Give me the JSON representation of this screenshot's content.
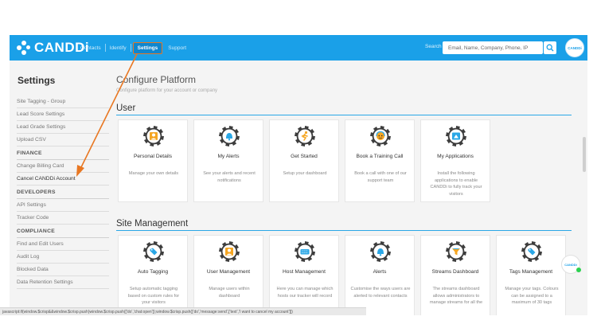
{
  "nav": {
    "brand": "CANDDi",
    "links": [
      "Contacts",
      "Identify",
      "Settings",
      "Support"
    ],
    "search_label": "Search",
    "search_placeholder": "Email, Name, Company, Phone, IP",
    "avatar_text": "CANDDi"
  },
  "sidebar": {
    "title": "Settings",
    "items": [
      {
        "label": "Site Tagging - Group",
        "type": "item"
      },
      {
        "label": "Lead Score Settings",
        "type": "item"
      },
      {
        "label": "Lead Grade Settings",
        "type": "item"
      },
      {
        "label": "Upload CSV",
        "type": "item"
      },
      {
        "label": "FINANCE",
        "type": "header"
      },
      {
        "label": "Change Billing Card",
        "type": "item"
      },
      {
        "label": "Cancel CANDDi Account",
        "type": "item"
      },
      {
        "label": "DEVELOPERS",
        "type": "header"
      },
      {
        "label": "API Settings",
        "type": "item"
      },
      {
        "label": "Tracker Code",
        "type": "item"
      },
      {
        "label": "COMPLIANCE",
        "type": "header"
      },
      {
        "label": "Find and Edit Users",
        "type": "item"
      },
      {
        "label": "Audit Log",
        "type": "item"
      },
      {
        "label": "Blocked Data",
        "type": "item"
      },
      {
        "label": "Data Retention Settings",
        "type": "item"
      }
    ]
  },
  "main": {
    "title": "Configure Platform",
    "subtitle": "Configure platform for your account or company",
    "sections": [
      {
        "title": "User",
        "cards": [
          {
            "title": "Personal Details",
            "desc": "Manage your own details",
            "icon": "person-badge-icon"
          },
          {
            "title": "My Alerts",
            "desc": "See your alerts and recent notifications",
            "icon": "bell-icon"
          },
          {
            "title": "Get Started",
            "desc": "Setup your dashboard",
            "icon": "running-person-icon"
          },
          {
            "title": "Book a Training Call",
            "desc": "Book a call with one of our support team",
            "icon": "support-agent-icon"
          },
          {
            "title": "My Applications",
            "desc": "Install the following applications to enable CANDDi to fully track your visitors",
            "icon": "application-icon"
          }
        ]
      },
      {
        "title": "Site Management",
        "cards": [
          {
            "title": "Auto Tagging",
            "desc": "Setup automatic tagging based on custom rules for your visitors",
            "icon": "tag-icon"
          },
          {
            "title": "User Management",
            "desc": "Manage users within dashboard",
            "icon": "person-badge-icon"
          },
          {
            "title": "Host Management",
            "desc": "Here you can manage which hosts our tracker will record",
            "icon": "keyboard-icon"
          },
          {
            "title": "Alerts",
            "desc": "Customise the ways users are alerted to relevant contacts",
            "icon": "bell-icon"
          },
          {
            "title": "Streams Dashboard",
            "desc": "The streams dashboard allows administrators to manage streams for all the",
            "icon": "funnel-icon"
          },
          {
            "title": "Tags Management",
            "desc": "Manage your tags. Colours can be assigned to a maximum of 30 tags",
            "icon": "tag-icon"
          }
        ]
      }
    ]
  },
  "statusbar": {
    "text": "javascript:if(window.$crisp&&window.$crisp.push)window.$crisp.push(['do','chat:open']);window.$crisp.push(['do','message:send',['text','I want to cancel my account']])"
  },
  "colors": {
    "brand_blue": "#1aa0e8",
    "annotation_orange": "#e87722",
    "gear_dark": "#3d3d3d",
    "icon_accent_orange": "#f5a623",
    "icon_accent_blue": "#2aa7e6"
  }
}
